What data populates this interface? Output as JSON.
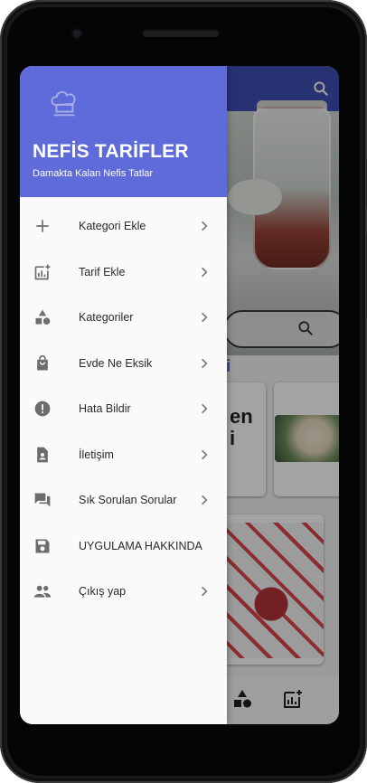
{
  "drawer": {
    "title": "NEFİS TARİFLER",
    "subtitle": "Damakta Kalan Nefis Tatlar",
    "items": [
      {
        "label": "Kategori Ekle",
        "icon": "plus-icon",
        "has_chevron": true
      },
      {
        "label": "Tarif Ekle",
        "icon": "add-chart-icon",
        "has_chevron": true
      },
      {
        "label": "Kategoriler",
        "icon": "shapes-icon",
        "has_chevron": true
      },
      {
        "label": "Evde Ne Eksik",
        "icon": "shopping-bag-icon",
        "has_chevron": true
      },
      {
        "label": "Hata Bildir",
        "icon": "error-icon",
        "has_chevron": true
      },
      {
        "label": "İletişim",
        "icon": "contact-card-icon",
        "has_chevron": true
      },
      {
        "label": "Sık Sorulan Sorular",
        "icon": "forum-icon",
        "has_chevron": true
      },
      {
        "label": "UYGULAMA HAKKINDA",
        "icon": "save-icon",
        "has_chevron": false
      },
      {
        "label": "Çıkış yap",
        "icon": "people-icon",
        "has_chevron": true
      }
    ]
  },
  "background_app": {
    "section_title_fragment": "eri",
    "card_title_fragment": "en\ni",
    "bottom_nav_icons": [
      "shapes-icon",
      "add-chart-icon"
    ]
  },
  "colors": {
    "drawer_header": "#5e6bd8",
    "app_bar": "#3f4fb5",
    "accent_text": "#5c6bd8",
    "icon_gray": "#6d6d6d"
  }
}
